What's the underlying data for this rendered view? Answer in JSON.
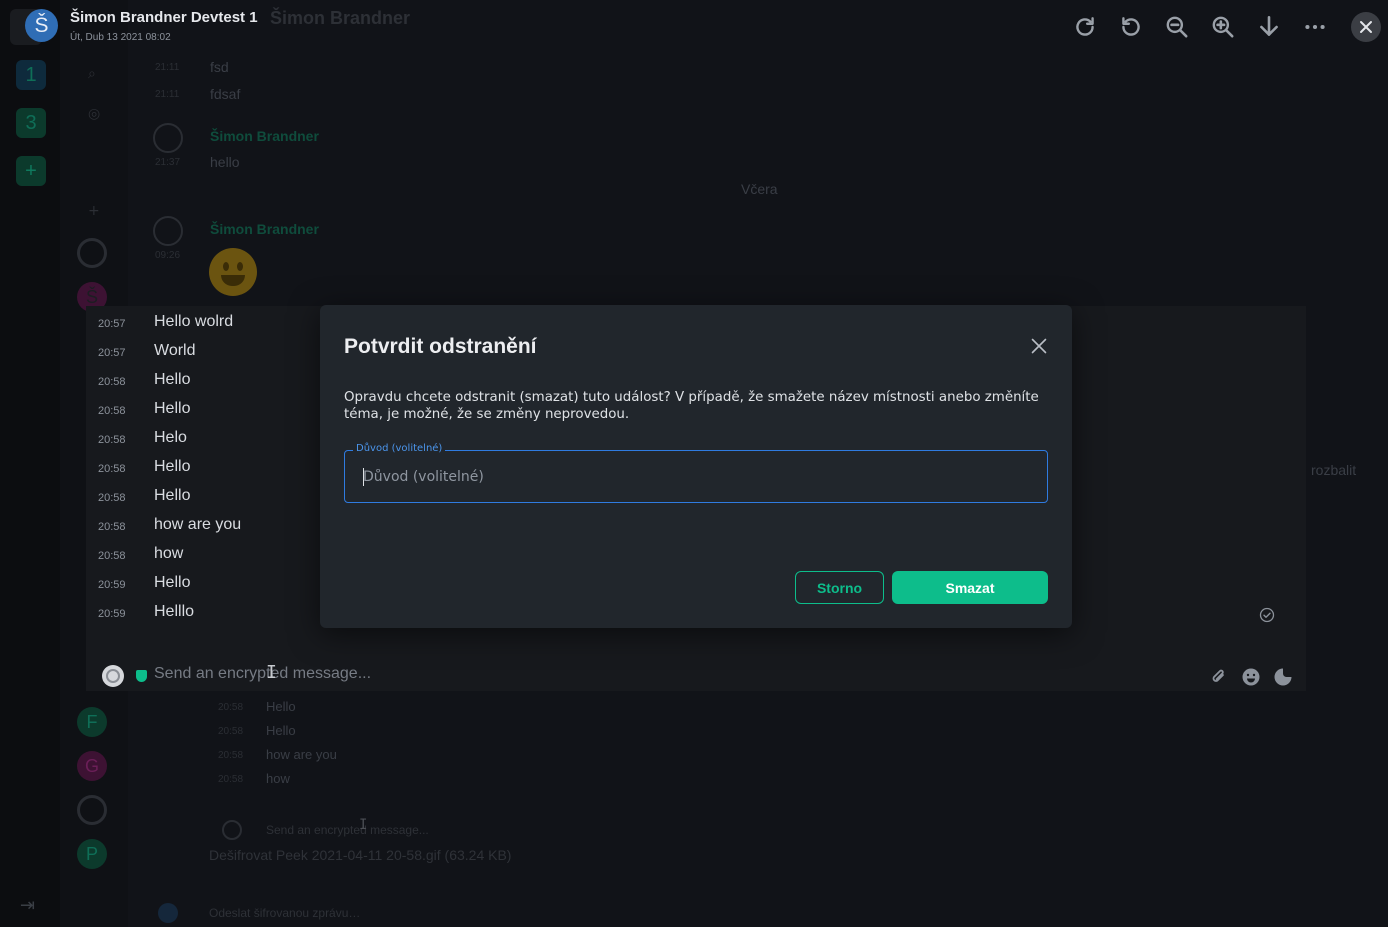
{
  "viewer": {
    "avatar_letter": "Š",
    "sender_name": "Šimon Brandner Devtest 1",
    "timestamp": "Út, Dub 13 2021 08:02",
    "behind_title": "Šimon Brandner",
    "actions": [
      "rotate-clockwise-icon",
      "rotate-counterclockwise-icon",
      "zoom-out-icon",
      "zoom-in-icon",
      "download-icon",
      "more-options-icon",
      "close-icon"
    ]
  },
  "background": {
    "spaces": [
      "1",
      "3",
      "+"
    ],
    "rooms": [
      "Š",
      "F",
      "G",
      "P"
    ],
    "timeline": [
      {
        "time": "21:11",
        "text": "fsd"
      },
      {
        "time": "21:11",
        "text": "fdsaf"
      },
      {
        "sender": "Šimon Brandner",
        "time": "21:37",
        "text": "hello"
      },
      {
        "separator": "Včera"
      },
      {
        "sender": "Šimon Brandner",
        "time": "09:26"
      }
    ],
    "lower_messages": [
      {
        "time": "20:58",
        "text": "Hello"
      },
      {
        "time": "20:58",
        "text": "Hello"
      },
      {
        "time": "20:58",
        "text": "how are you"
      },
      {
        "time": "20:58",
        "text": "how"
      }
    ],
    "lower_composer_placeholder": "Send an encrypted message...",
    "file_line": "Dešifrovat Peek 2021-04-11 20-58.gif (63.24 KB)",
    "bottom_composer_placeholder": "Odeslat šifrovanou zprávu…",
    "expand_label": "rozbalit"
  },
  "zoomed": {
    "messages": [
      {
        "time": "20:57",
        "text": "Hello wolrd"
      },
      {
        "time": "20:57",
        "text": "World"
      },
      {
        "time": "20:58",
        "text": "Hello"
      },
      {
        "time": "20:58",
        "text": "Hello"
      },
      {
        "time": "20:58",
        "text": "Helo"
      },
      {
        "time": "20:58",
        "text": "Hello"
      },
      {
        "time": "20:58",
        "text": "Hello"
      },
      {
        "time": "20:58",
        "text": "how are you"
      },
      {
        "time": "20:58",
        "text": "how"
      },
      {
        "time": "20:59",
        "text": "Hello"
      },
      {
        "time": "20:59",
        "text": "Helllo"
      }
    ],
    "composer_placeholder": "Send an encrypted message..."
  },
  "dialog": {
    "title": "Potvrdit odstranění",
    "body": "Opravdu chcete odstranit (smazat) tuto událost? V případě, že smažete název místnosti anebo změníte téma, je možné, že se změny neprovedou.",
    "reason_label": "Důvod (volitelné)",
    "reason_placeholder": "Důvod (volitelné)",
    "reason_value": "",
    "cancel_label": "Storno",
    "confirm_label": "Smazat"
  },
  "colors": {
    "accent": "#0dbd8b",
    "focus": "#2f7be0",
    "dialog_bg": "#21262c",
    "avatar_blue": "#2f6db5"
  }
}
